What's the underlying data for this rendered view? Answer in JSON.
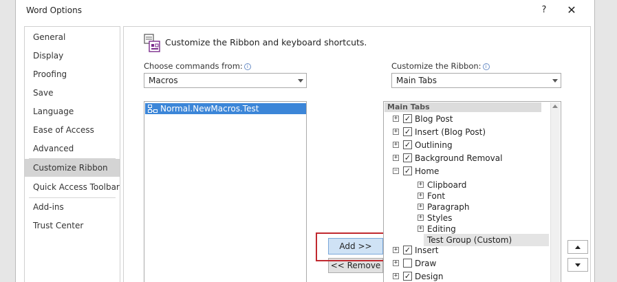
{
  "window": {
    "title": "Word Options",
    "help_label": "?",
    "close_label": "✕"
  },
  "nav": {
    "items": [
      {
        "label": "General"
      },
      {
        "label": "Display"
      },
      {
        "label": "Proofing"
      },
      {
        "label": "Save"
      },
      {
        "label": "Language"
      },
      {
        "label": "Ease of Access"
      },
      {
        "label": "Advanced"
      },
      {
        "label": "Customize Ribbon",
        "selected": true
      },
      {
        "label": "Quick Access Toolbar"
      },
      {
        "label": "Add-ins"
      },
      {
        "label": "Trust Center"
      }
    ]
  },
  "header": {
    "text": "Customize the Ribbon and keyboard shortcuts."
  },
  "left_panel": {
    "label": "Choose commands from:",
    "dropdown_value": "Macros",
    "items": [
      {
        "label": "Normal.NewMacros.Test",
        "selected": true
      }
    ]
  },
  "right_panel": {
    "label": "Customize the Ribbon:",
    "dropdown_value": "Main Tabs",
    "tree_header": "Main Tabs",
    "tree": [
      {
        "label": "Blog Post",
        "expander": "+",
        "checked": true
      },
      {
        "label": "Insert (Blog Post)",
        "expander": "+",
        "checked": true
      },
      {
        "label": "Outlining",
        "expander": "+",
        "checked": true
      },
      {
        "label": "Background Removal",
        "expander": "+",
        "checked": true
      },
      {
        "label": "Home",
        "expander": "−",
        "checked": true
      },
      {
        "label": "Clipboard",
        "expander": "+"
      },
      {
        "label": "Font",
        "expander": "+"
      },
      {
        "label": "Paragraph",
        "expander": "+"
      },
      {
        "label": "Styles",
        "expander": "+"
      },
      {
        "label": "Editing",
        "expander": "+"
      },
      {
        "label": "Test Group (Custom)"
      },
      {
        "label": "Insert",
        "expander": "+",
        "checked": true
      },
      {
        "label": "Draw",
        "expander": "+",
        "checked": false
      },
      {
        "label": "Design",
        "expander": "+",
        "checked": true
      }
    ]
  },
  "buttons": {
    "add": "Add >>",
    "remove": "<< Remove"
  },
  "colors": {
    "selection": "#3c86d8",
    "highlight_box": "#c0282e",
    "selected_nav": "#d4d4d4"
  }
}
